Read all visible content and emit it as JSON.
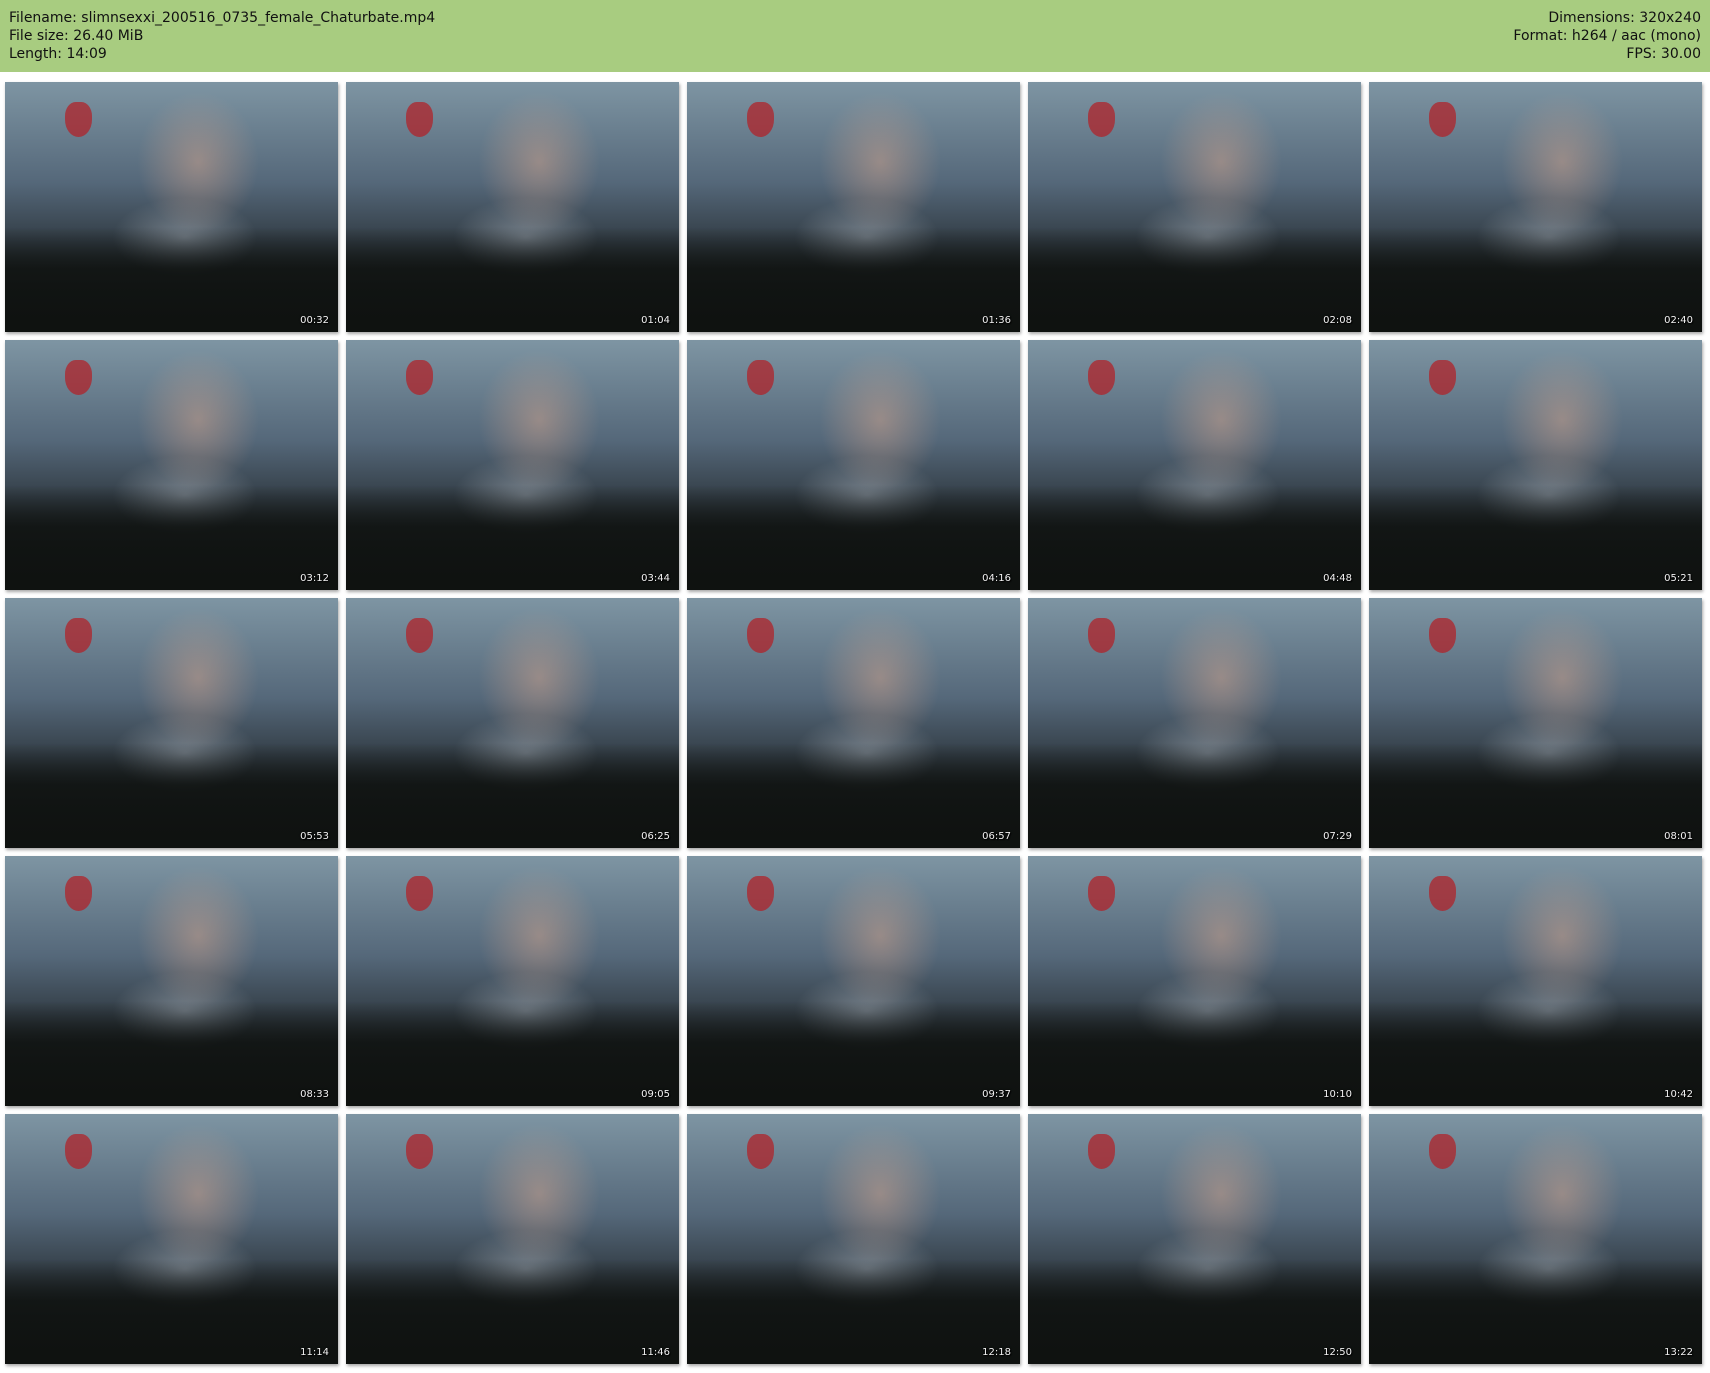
{
  "header": {
    "filename": "Filename: slimnsexxi_200516_0735_female_Chaturbate.mp4",
    "filesize": "File size: 26.40 MiB",
    "length": "Length: 14:09",
    "dimensions": "Dimensions: 320x240",
    "format": "Format: h264 / aac (mono)",
    "fps": "FPS: 30.00"
  },
  "colors": {
    "header_bg": "#a8cc80"
  },
  "thumbnails": [
    {
      "time": "00:32"
    },
    {
      "time": "01:04"
    },
    {
      "time": "01:36"
    },
    {
      "time": "02:08"
    },
    {
      "time": "02:40"
    },
    {
      "time": "03:12"
    },
    {
      "time": "03:44"
    },
    {
      "time": "04:16"
    },
    {
      "time": "04:48"
    },
    {
      "time": "05:21"
    },
    {
      "time": "05:53"
    },
    {
      "time": "06:25"
    },
    {
      "time": "06:57"
    },
    {
      "time": "07:29"
    },
    {
      "time": "08:01"
    },
    {
      "time": "08:33"
    },
    {
      "time": "09:05"
    },
    {
      "time": "09:37"
    },
    {
      "time": "10:10"
    },
    {
      "time": "10:42"
    },
    {
      "time": "11:14"
    },
    {
      "time": "11:46"
    },
    {
      "time": "12:18"
    },
    {
      "time": "12:50"
    },
    {
      "time": "13:22"
    }
  ]
}
